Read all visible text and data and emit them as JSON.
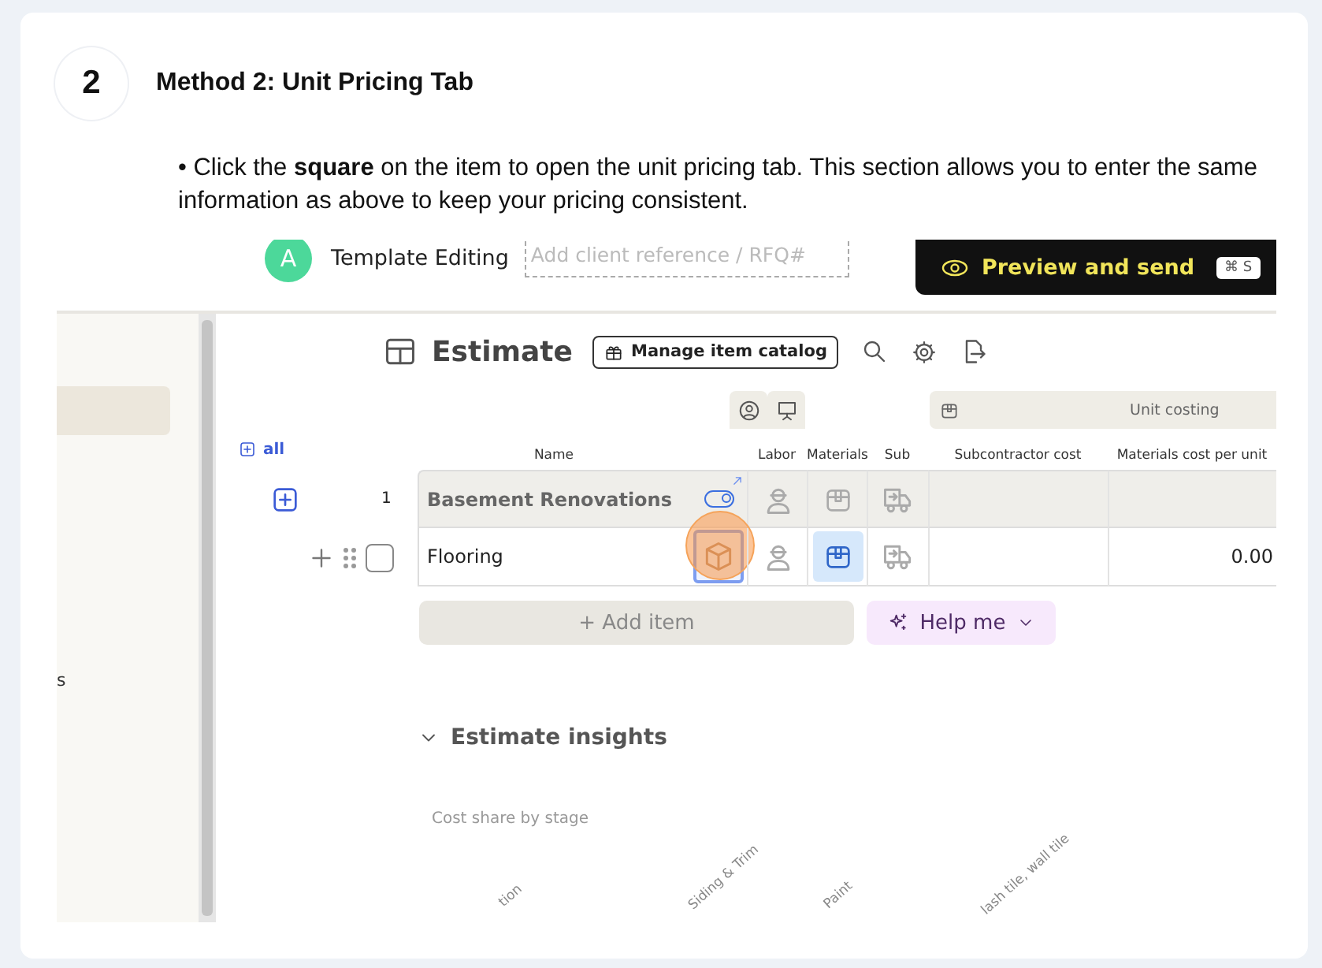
{
  "guide": {
    "step_number": "2",
    "title": "Method 2: Unit Pricing Tab",
    "instruction": "• Click the **square** on the item to open the unit pricing tab. This section allows you to enter the same information as above to keep your pricing consistent."
  },
  "app": {
    "topbar": {
      "avatar": "A",
      "project": "Template Editing",
      "reference_field": {
        "placeholder": "Add client reference / RFQ#"
      },
      "preview_button": "Preview and send",
      "shortcut": "⌘ S"
    },
    "sidebar": {
      "cut_text": "s"
    },
    "estimate": {
      "title": "Estimate",
      "catalog_button": "Manage item catalog",
      "expand_all": "all",
      "unit_costing": "Unit costing",
      "columns": [
        "Name",
        "Labor",
        "Materials",
        "Sub",
        "Subcontractor cost",
        "Materials cost per unit"
      ],
      "rows": [
        {
          "kind": "group",
          "number": "1",
          "name": "Basement Renovations",
          "toggle_on": true,
          "materials_selected": false
        },
        {
          "kind": "item",
          "name": "Flooring",
          "checked": false,
          "unit_pricing_selected": true,
          "materials_selected": true,
          "materials_cost": "0.00"
        }
      ],
      "add_item": "+ Add item",
      "help_button": "Help me"
    },
    "insights": {
      "title": "Estimate insights",
      "chart_title": "Cost share by stage",
      "stage_labels": [
        "tion",
        "Siding & Trim",
        "Paint",
        "lash tile, wall tile"
      ]
    }
  }
}
